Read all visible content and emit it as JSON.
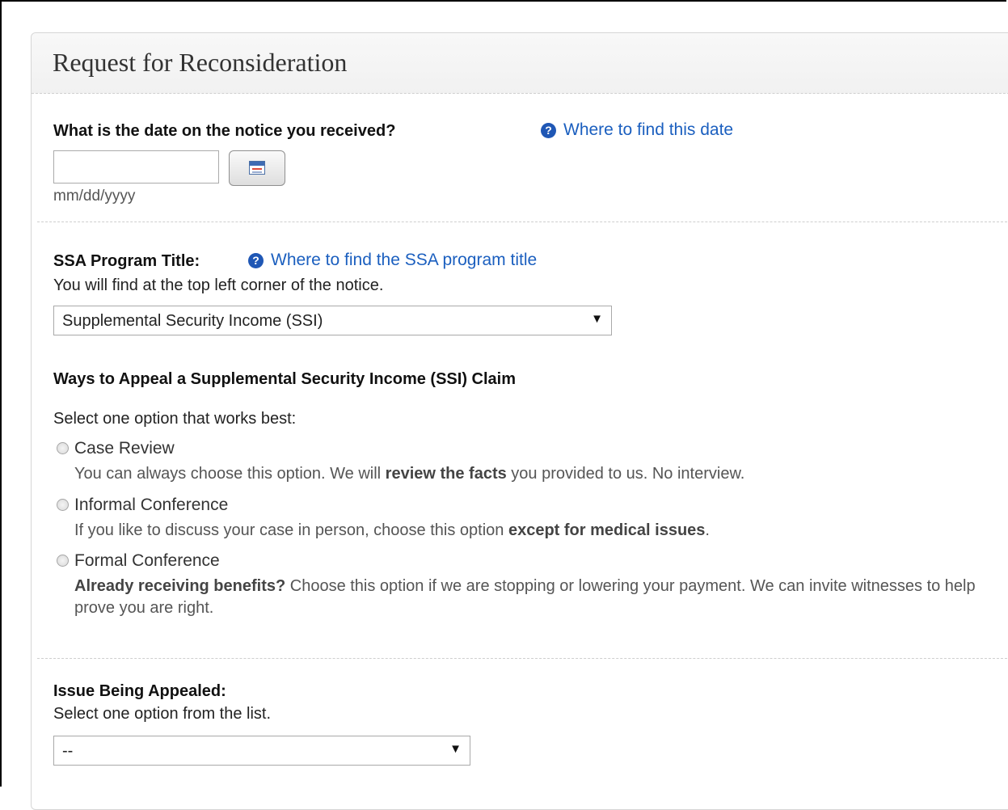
{
  "panel": {
    "title": "Request for Reconsideration"
  },
  "notice_date": {
    "label": "What is the date on the notice you received?",
    "help_link": "Where to find this date",
    "value": "",
    "format_hint": "mm/dd/yyyy"
  },
  "program": {
    "label": "SSA Program Title:",
    "help_link": "Where to find the SSA program title",
    "hint": "You will find at the top left corner of the notice.",
    "selected": "Supplemental Security Income (SSI)"
  },
  "appeal": {
    "heading": "Ways to Appeal a Supplemental Security Income (SSI) Claim",
    "instruction": "Select one option that works best:",
    "options": [
      {
        "label": "Case Review",
        "desc_1": "You can always choose this option. We will ",
        "desc_bold": "review the facts",
        "desc_2": " you provided to us. No interview.",
        "selected": false
      },
      {
        "label": "Informal Conference",
        "desc_1": "If you like to discuss your case in person, choose this option ",
        "desc_bold": "except for medical issues",
        "desc_2": ".",
        "selected": false
      },
      {
        "label": "Formal Conference",
        "desc_bold": "Already receiving benefits?",
        "desc_2": " Choose this option if we are stopping or lowering your payment. We can invite witnesses to help prove you are right.",
        "selected": false
      }
    ]
  },
  "issue": {
    "label": "Issue Being Appealed:",
    "hint": "Select one option from the list.",
    "selected": "--"
  }
}
